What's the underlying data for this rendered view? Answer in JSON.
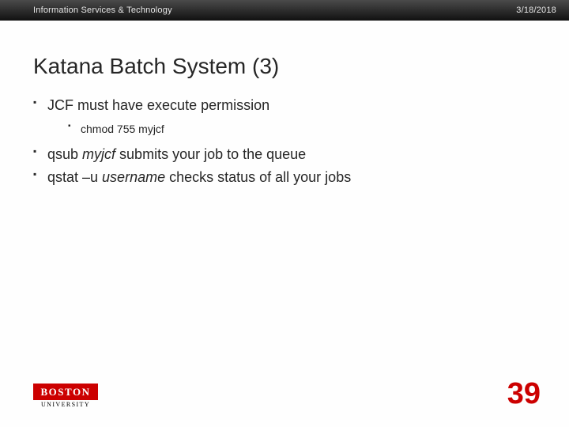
{
  "header": {
    "org": "Information Services & Technology",
    "date": "3/18/2018"
  },
  "title": "Katana Batch System (3)",
  "bullets": {
    "b1": {
      "text": "JCF must have execute permission"
    },
    "b1a": {
      "text": "chmod 755 myjcf"
    },
    "b2_pre": "qsub ",
    "b2_em": "myjcf",
    "b2_post": " submits your job to the queue",
    "b3_pre": "qstat –u ",
    "b3_em": "username",
    "b3_post": " checks status of all your jobs"
  },
  "logo": {
    "top": "BOSTON",
    "bottom": "UNIVERSITY"
  },
  "page_number": "39"
}
